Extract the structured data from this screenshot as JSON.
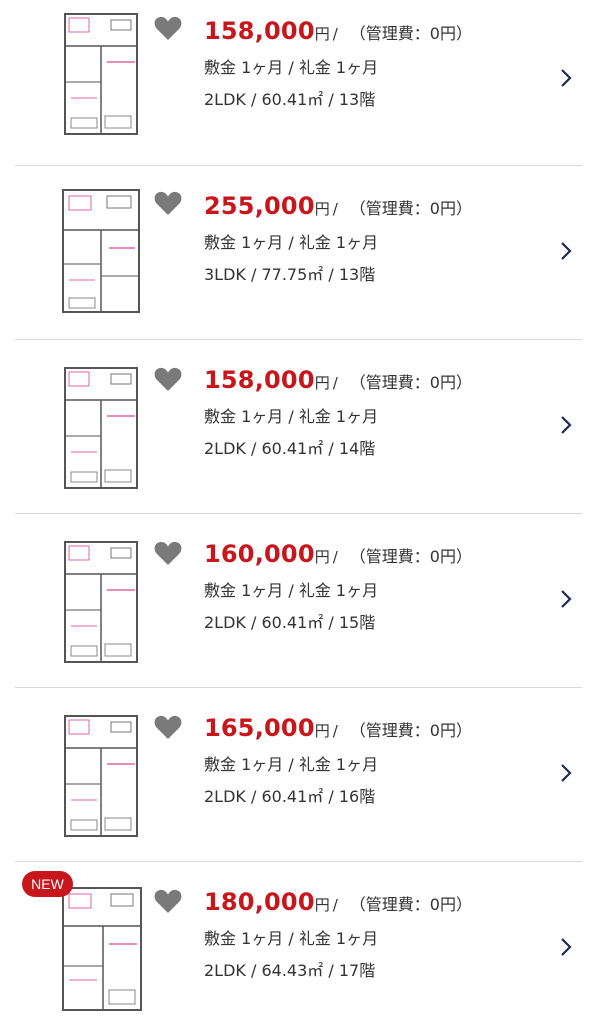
{
  "listings": [
    {
      "price": "158,000",
      "yen": "円",
      "slash": "/",
      "mgmt": "（管理費：0円）",
      "deposit": "敷金 1ヶ月 / 礼金 1ヶ月",
      "spec": "2LDK / 60.41㎡ / 13階",
      "is_new": false
    },
    {
      "price": "255,000",
      "yen": "円",
      "slash": "/",
      "mgmt": "（管理費：0円）",
      "deposit": "敷金 1ヶ月 / 礼金 1ヶ月",
      "spec": "3LDK / 77.75㎡ / 13階",
      "is_new": false
    },
    {
      "price": "158,000",
      "yen": "円",
      "slash": "/",
      "mgmt": "（管理費：0円）",
      "deposit": "敷金 1ヶ月 / 礼金 1ヶ月",
      "spec": "2LDK / 60.41㎡ / 14階",
      "is_new": false
    },
    {
      "price": "160,000",
      "yen": "円",
      "slash": "/",
      "mgmt": "（管理費：0円）",
      "deposit": "敷金 1ヶ月 / 礼金 1ヶ月",
      "spec": "2LDK / 60.41㎡ / 15階",
      "is_new": false
    },
    {
      "price": "165,000",
      "yen": "円",
      "slash": "/",
      "mgmt": "（管理費：0円）",
      "deposit": "敷金 1ヶ月 / 礼金 1ヶ月",
      "spec": "2LDK / 60.41㎡ / 16階",
      "is_new": false
    },
    {
      "price": "180,000",
      "yen": "円",
      "slash": "/",
      "mgmt": "（管理費：0円）",
      "deposit": "敷金 1ヶ月 / 礼金 1ヶ月",
      "spec": "2LDK / 64.43㎡ / 17階",
      "is_new": true,
      "badge": "NEW"
    }
  ],
  "colors": {
    "price": "#c8161d",
    "badge": "#c8161d",
    "heart": "#7a7a7a",
    "chevron": "#1f2a55",
    "divider": "#d9d9d9"
  },
  "icons": {
    "favorite": "heart-icon",
    "open": "chevron-right-icon"
  }
}
